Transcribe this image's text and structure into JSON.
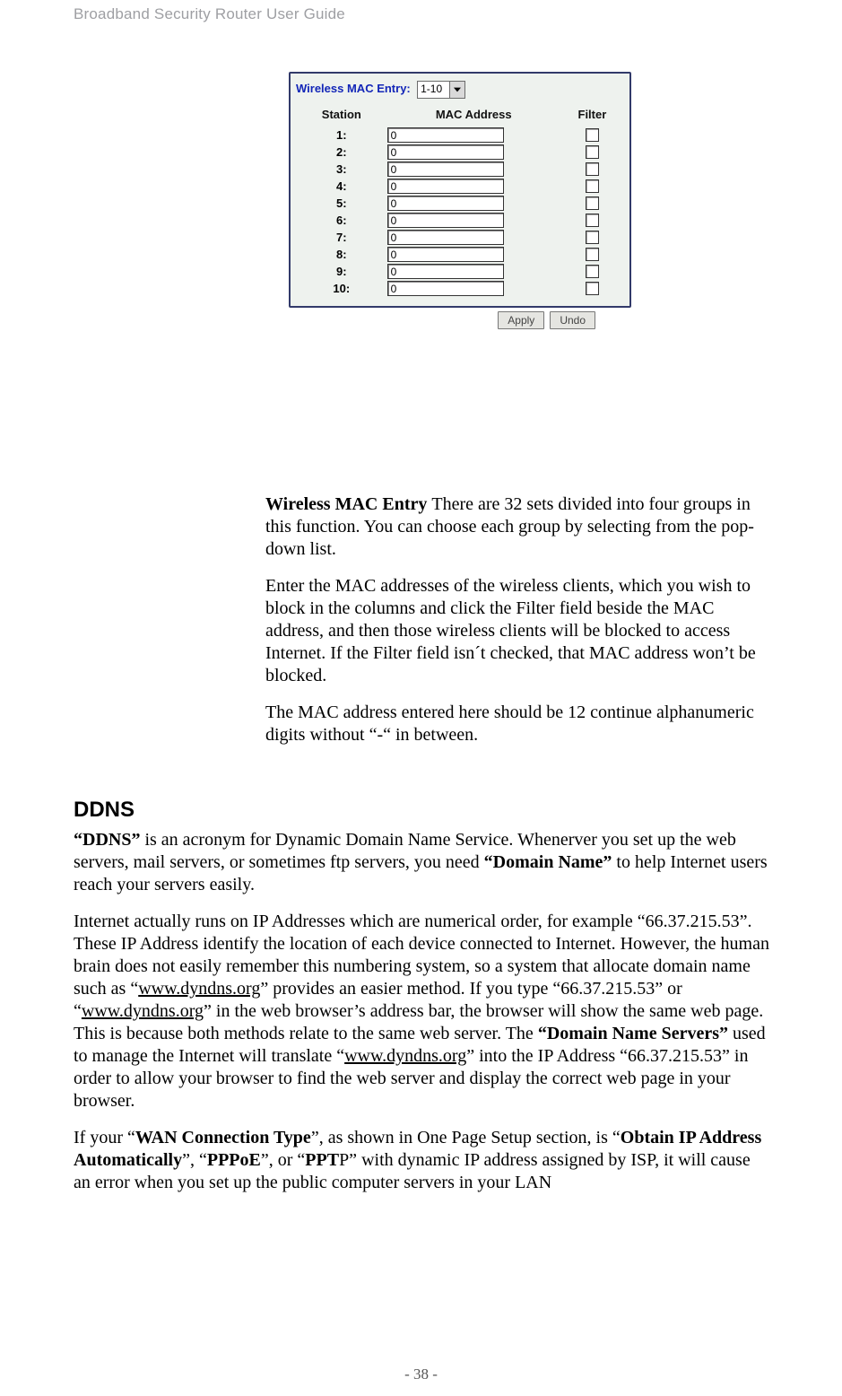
{
  "header": {
    "text": "Broadband Security Router User Guide"
  },
  "footer": {
    "text": "- 38 -"
  },
  "panel": {
    "label": "Wireless MAC Entry:",
    "select_value": "1-10",
    "headers": {
      "station": "Station",
      "mac": "MAC Address",
      "filter": "Filter"
    },
    "rows": [
      {
        "station": "1:",
        "value": "0"
      },
      {
        "station": "2:",
        "value": "0"
      },
      {
        "station": "3:",
        "value": "0"
      },
      {
        "station": "4:",
        "value": "0"
      },
      {
        "station": "5:",
        "value": "0"
      },
      {
        "station": "6:",
        "value": "0"
      },
      {
        "station": "7:",
        "value": "0"
      },
      {
        "station": "8:",
        "value": "0"
      },
      {
        "station": "9:",
        "value": "0"
      },
      {
        "station": "10:",
        "value": "0"
      }
    ],
    "buttons": {
      "apply": "Apply",
      "undo": "Undo"
    }
  },
  "text": {
    "p1_strong": "Wireless MAC Entry ",
    "p1_rest": "There are 32 sets divided into four groups in this function. You can choose each group by selecting from the pop-down list.",
    "p2": "Enter the MAC addresses of the wireless clients, which you wish to block in the columns and click the Filter field beside the MAC address, and then those wireless clients will be blocked to access Internet. If the Filter field isn´t checked, that MAC address won’t be blocked.",
    "p3": "The MAC address entered here should be 12 continue alphanumeric digits without “-“ in between.",
    "ddns_h": "DDNS",
    "p4a": "“DDNS”",
    "p4b": " is an acronym for Dynamic Domain Name Service. Whenerver you set up the web servers, mail servers, or sometimes ftp servers, you need ",
    "p4c": "“Domain Name”",
    "p4d": " to help Internet users reach your servers easily.",
    "p5a": "Internet actually runs on IP Addresses which are numerical order, for example “66.37.215.53”. These IP Address identify the location of each device connected to Internet. However, the human brain does not easily remember this numbering system, so a system that allocate domain name such as “",
    "p5link1": "www.dyndns.org",
    "p5b": "” provides an easier method. If you type “66.37.215.53” or “",
    "p5link2": "www.dyndns.org",
    "p5c": "” in the web browser’s address bar, the browser will show the same web page. This is because both methods relate to the same web server. The ",
    "p5d": "“Domain Name Servers”",
    "p5e": " used to manage the Internet will translate “",
    "p5link3": "www.dyndns.org",
    "p5f": "” into the IP Address “66.37.215.53” in order to allow your browser to find the web server and display the correct web page in your browser.",
    "p6a": "If your “",
    "p6b": "WAN Connection Type",
    "p6c": "”, as shown in One Page Setup section, is “",
    "p6d": "Obtain IP Address Automatically",
    "p6e": "”, “",
    "p6f": "PPPoE",
    "p6g": "”, or “",
    "p6h": "PPT",
    "p6i": "P” with dynamic IP address assigned by ISP, it will cause an error when you set up the public computer servers in your LAN"
  }
}
